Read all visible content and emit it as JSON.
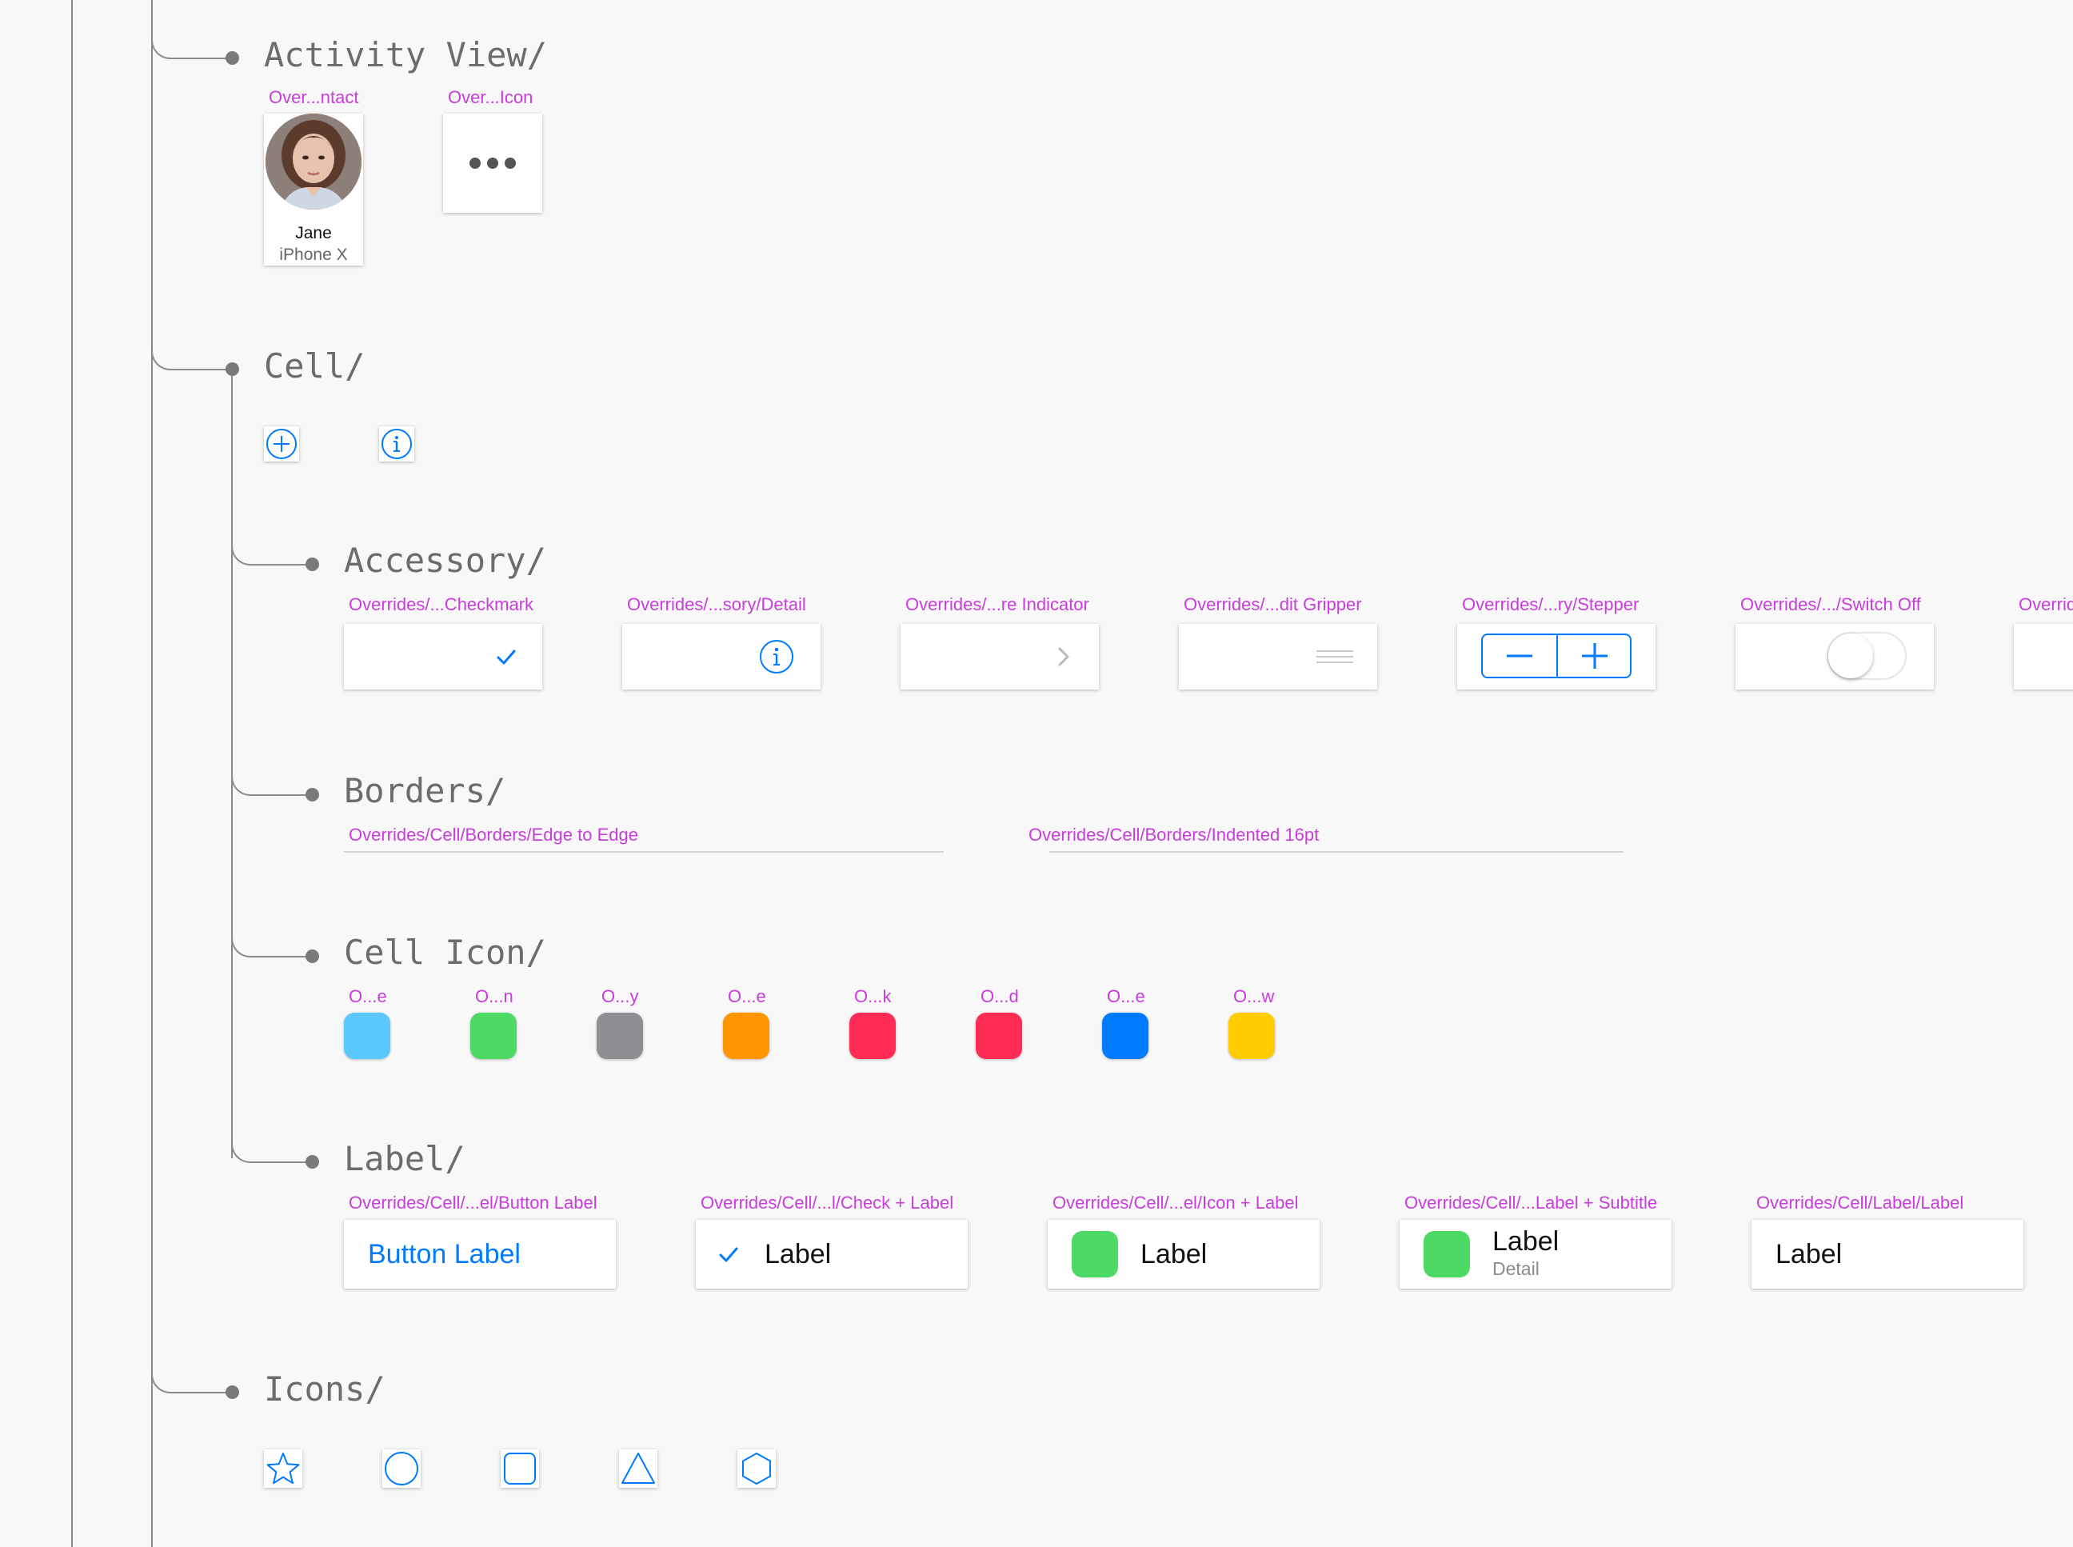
{
  "sections": {
    "activity_view": {
      "title": "Activity View/",
      "contact_override": "Over...ntact",
      "icon_override": "Over...Icon",
      "contact_name": "Jane",
      "contact_device": "iPhone X"
    },
    "cell": {
      "title": "Cell/"
    },
    "accessory": {
      "title": "Accessory/",
      "items": [
        {
          "label": "Overrides/...Checkmark",
          "icon": "checkmark-icon"
        },
        {
          "label": "Overrides/...sory/Detail",
          "icon": "info-icon"
        },
        {
          "label": "Overrides/...re Indicator",
          "icon": "chevron-right-icon"
        },
        {
          "label": "Overrides/...dit Gripper",
          "icon": "gripper-icon"
        },
        {
          "label": "Overrides/...ry/Stepper",
          "icon": "stepper"
        },
        {
          "label": "Overrides/.../Switch Off",
          "icon": "switch-off"
        },
        {
          "label": "Overrid"
        }
      ]
    },
    "borders": {
      "title": "Borders/",
      "items": [
        {
          "label": "Overrides/Cell/Borders/Edge to Edge"
        },
        {
          "label": "Overrides/Cell/Borders/Indented 16pt"
        }
      ]
    },
    "cell_icon": {
      "title": "Cell Icon/",
      "items": [
        {
          "label": "O...e",
          "color": "#5ac8fa"
        },
        {
          "label": "O...n",
          "color": "#4cd964"
        },
        {
          "label": "O...y",
          "color": "#8e8e93"
        },
        {
          "label": "O...e",
          "color": "#ff9500"
        },
        {
          "label": "O...k",
          "color": "#ff2d55"
        },
        {
          "label": "O...d",
          "color": "#ff2d55"
        },
        {
          "label": "O...e",
          "color": "#007aff"
        },
        {
          "label": "O...w",
          "color": "#ffcc00"
        }
      ]
    },
    "label": {
      "title": "Label/",
      "items": [
        {
          "override": "Overrides/Cell/...el/Button Label",
          "text": "Button Label"
        },
        {
          "override": "Overrides/Cell/...l/Check + Label",
          "text": "Label"
        },
        {
          "override": "Overrides/Cell/...el/Icon + Label",
          "text": "Label"
        },
        {
          "override": "Overrides/Cell/...Label + Subtitle",
          "text": "Label",
          "detail": "Detail"
        },
        {
          "override": "Overrides/Cell/Label/Label",
          "text": "Label"
        }
      ]
    },
    "icons": {
      "title": "Icons/"
    }
  },
  "colors": {
    "accent": "#007aff",
    "override_label": "#c83ddb",
    "heading": "#6c6c6c",
    "tree_line": "#8b8b8b",
    "green": "#4cd964"
  }
}
